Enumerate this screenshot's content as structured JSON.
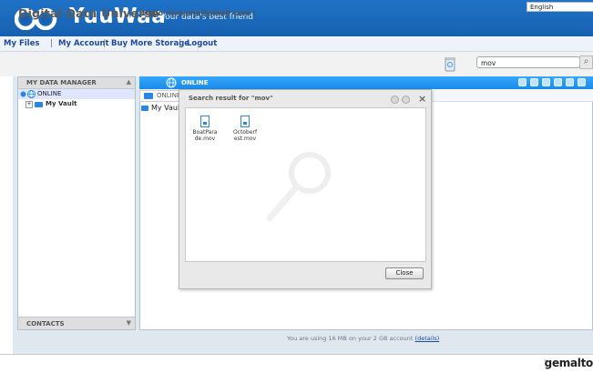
{
  "header": {
    "logo_text": "YuuWaa",
    "tagline": "Your data's best friend"
  },
  "topnav": {
    "items": [
      "My Files",
      "My Account",
      "Buy More Storage",
      "Logout"
    ],
    "separator": "|",
    "language": "English"
  },
  "title_row": {
    "app_title": "Digital Data Universe",
    "greeting": "Hello myname@email.com !",
    "search_value": "mov"
  },
  "left_panel": {
    "header": "MY DATA MANAGER",
    "tree": [
      {
        "label": "ONLINE"
      },
      {
        "label": "My Vault"
      }
    ],
    "contacts": "CONTACTS"
  },
  "right_panel": {
    "title": "ONLINE",
    "breadcrumb": "ONLINE",
    "row_label": "My Vault"
  },
  "status": {
    "text": "You are using 16 MB on your 2 GB account",
    "link": "(details)"
  },
  "dialog": {
    "title": "Search result for \"mov\"",
    "files": [
      {
        "line1": "BoatPara",
        "line2": "de.mov"
      },
      {
        "line1": "Octoberf",
        "line2": "est.mov"
      }
    ],
    "close_label": "Close"
  },
  "footer": {
    "brand": "gemalto",
    "tm": "™"
  },
  "colors": {
    "header_blue": "#1760b0",
    "online_bar": "#1a8ae8",
    "link_blue": "#1f4aa0"
  }
}
